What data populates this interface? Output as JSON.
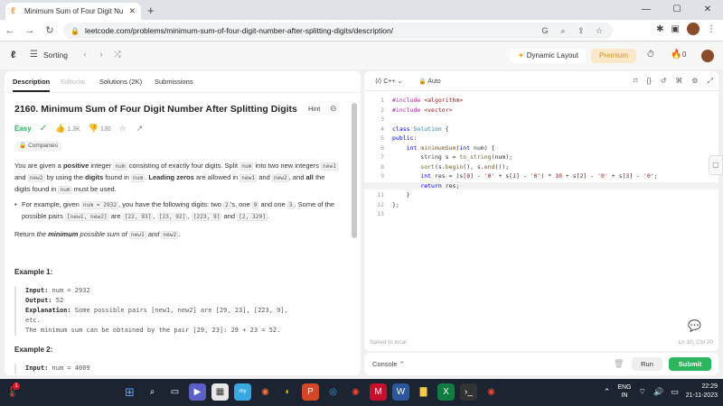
{
  "browser": {
    "tab_title": "Minimum Sum of Four Digit Nu",
    "tab_close": "✕",
    "new_tab": "+",
    "url": "leetcode.com/problems/minimum-sum-of-four-digit-number-after-splitting-digits/description/"
  },
  "lc_nav": {
    "problem_list_label": "Sorting",
    "dynamic_layout_label": "Dynamic Layout",
    "premium_label": "Premium",
    "notification_count": "0"
  },
  "left_tabs": {
    "description": "Description",
    "editorial": "Editorial",
    "solutions": "Solutions (2K)",
    "submissions": "Submissions"
  },
  "problem": {
    "title": "2160. Minimum Sum of Four Digit Number After Splitting Digits",
    "hint_label": "Hint",
    "difficulty": "Easy",
    "likes": "1.3K",
    "dislikes": "130",
    "companies_label": "Companies"
  },
  "example1": {
    "heading": "Example 1:",
    "input_label": "Input:",
    "input_value": "num = 2932",
    "output_label": "Output:",
    "output_value": "52",
    "explanation_label": "Explanation:",
    "explanation_value": "Some possible pairs [new1, new2] are [29, 23], [223, 9],",
    "explanation_cont": "etc.",
    "explanation_line2": "The minimum sum can be obtained by the pair [29, 23]: 29 + 23 = 52."
  },
  "example2": {
    "heading": "Example 2:",
    "input_label": "Input:",
    "input_value": "num = 4009"
  },
  "editor": {
    "language": "C++",
    "mode": "Auto",
    "saved_status": "Saved to local",
    "cursor_pos": "Ln 10, Col 20",
    "line_numbers": [
      "1",
      "2",
      "3",
      "4",
      "5",
      "6",
      "7",
      "8",
      "9",
      "10",
      "11",
      "12",
      "13"
    ]
  },
  "console_bar": {
    "console_label": "Console",
    "run_label": "Run",
    "submit_label": "Submit"
  },
  "taskbar": {
    "lang_line1": "ENG",
    "lang_line2": "IN",
    "time": "22:29",
    "date": "21-11-2023",
    "notification_badge": "1"
  }
}
